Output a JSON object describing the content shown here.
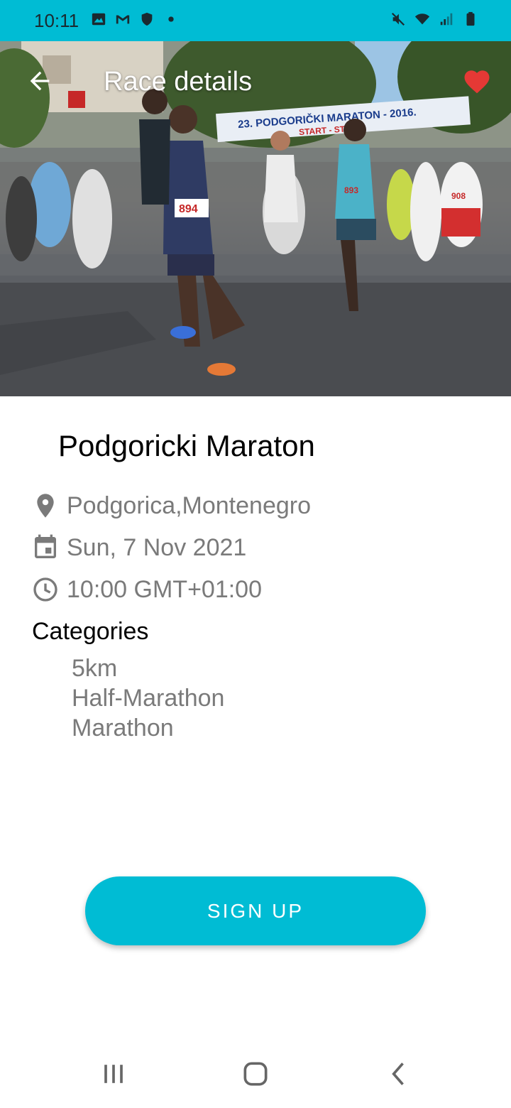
{
  "status_bar": {
    "time": "10:11",
    "left_icons": [
      "image-icon",
      "gmail-icon",
      "shield-icon",
      "dot-icon"
    ],
    "right_icons": [
      "mute-icon",
      "wifi-icon",
      "signal-icon",
      "battery-icon"
    ],
    "background": "#00bcd4"
  },
  "app_bar": {
    "title": "Race details",
    "back_icon": "arrow-back-icon",
    "favorite_icon": "heart-icon",
    "favorite_color": "#e53935"
  },
  "hero": {
    "banner_line1": "23. PODGORIČKI MARATON - 2016.",
    "banner_line2": "START - START",
    "bibs": [
      "894",
      "893",
      "908"
    ]
  },
  "race": {
    "name": "Podgoricki Maraton",
    "location": "Podgorica,Montenegro",
    "date": "Sun, 7 Nov 2021",
    "time": "10:00 GMT+01:00",
    "categories_title": "Categories",
    "categories": [
      "5km",
      "Half-Marathon",
      "Marathon"
    ]
  },
  "actions": {
    "signup_label": "SIGN UP",
    "accent": "#00bcd4"
  },
  "nav_bar": {
    "icons": [
      "recent-apps-icon",
      "home-icon",
      "back-icon"
    ]
  }
}
